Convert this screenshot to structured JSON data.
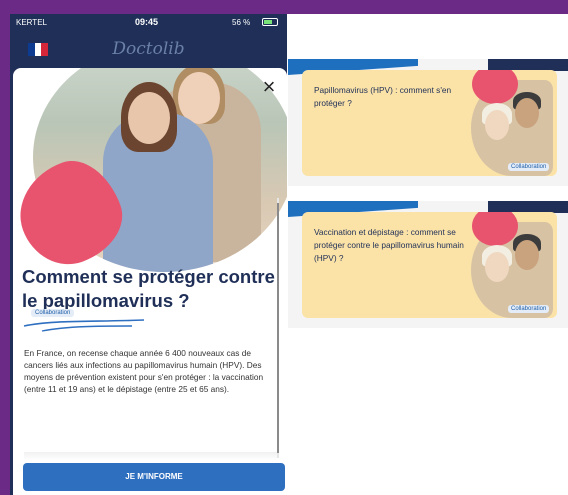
{
  "status_bar": {
    "carrier": "KERTEL",
    "time": "09:45",
    "battery": "56 %"
  },
  "app": {
    "logo": "Doctolib",
    "flag_colors": [
      "#0d3b91",
      "#ffffff",
      "#d5263a"
    ]
  },
  "sheet": {
    "title": "Comment se protéger contre le papillomavirus ?",
    "tag": "Collaboration",
    "body": "En France, on recense chaque année 6 400 nouveaux cas de cancers liés aux infections au papillomavirus humain (HPV). Des moyens de prévention existent pour s'en protéger : la vaccination (entre 11 et 19 ans) et le dépistage (entre 25 et 65 ans).",
    "cta": "JE M'INFORME"
  },
  "cards": [
    {
      "title": "Papillomavirus (HPV) : comment s'en protéger ?",
      "tag": "Collaboration"
    },
    {
      "title": "Vaccination et dépistage : comment se protéger contre le papillomavirus humain (HPV) ?",
      "tag": "Collaboration"
    }
  ],
  "colors": {
    "background": "#6a2a86",
    "navy": "#1f2f57",
    "accent_blue": "#2f6fc0",
    "pink": "#e8546e",
    "card_yellow": "#fbe3a8"
  }
}
